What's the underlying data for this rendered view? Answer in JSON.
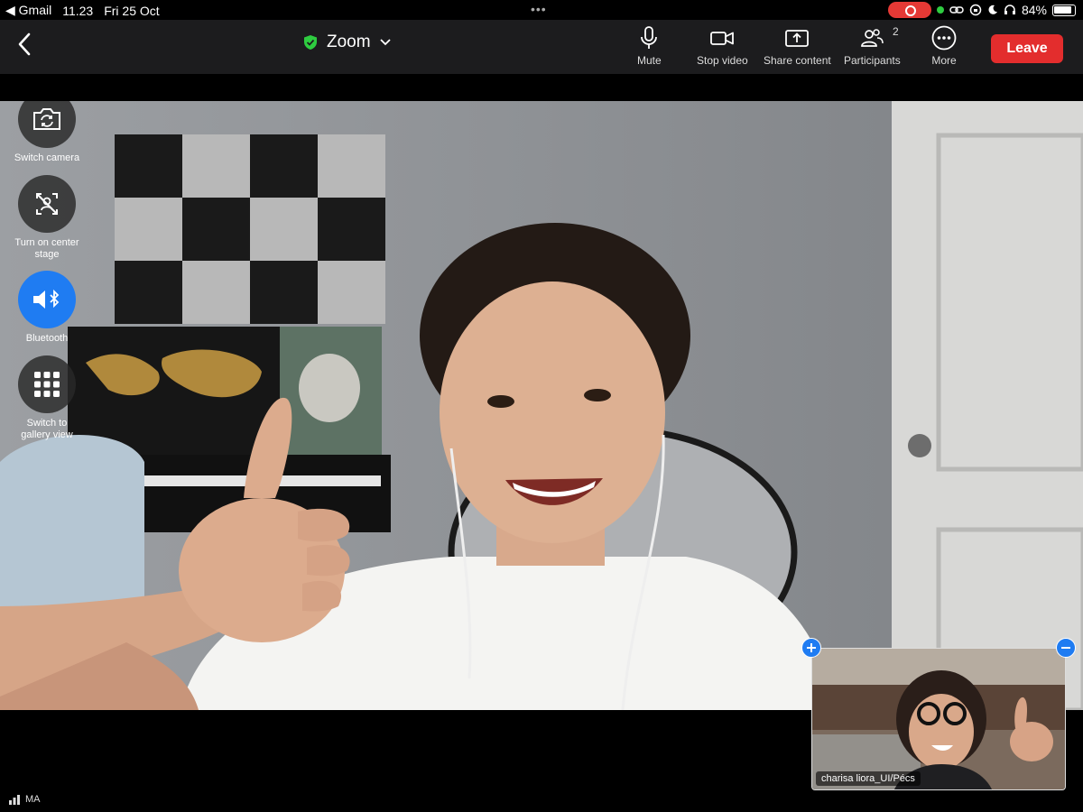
{
  "status_bar": {
    "back_app": "◀ Gmail",
    "time": "11.23",
    "date": "Fri 25 Oct",
    "battery": "84%"
  },
  "toolbar": {
    "meeting_title": "Zoom",
    "mute_label": "Mute",
    "stop_video_label": "Stop video",
    "share_label": "Share content",
    "participants_label": "Participants",
    "participants_count": "2",
    "more_label": "More",
    "leave_label": "Leave"
  },
  "side_controls": {
    "switch_camera": "Switch camera",
    "center_stage": "Turn on center stage",
    "bluetooth": "Bluetooth",
    "gallery_view": "Switch to gallery view"
  },
  "self_view": {
    "name": "charisa liora_UI/Pécs"
  },
  "network": {
    "label": "MA"
  },
  "colors": {
    "accent": "#1f7cf2",
    "leave": "#e32d2d",
    "toolbar_bg": "#1c1c1e",
    "shield": "#2ecc40"
  }
}
